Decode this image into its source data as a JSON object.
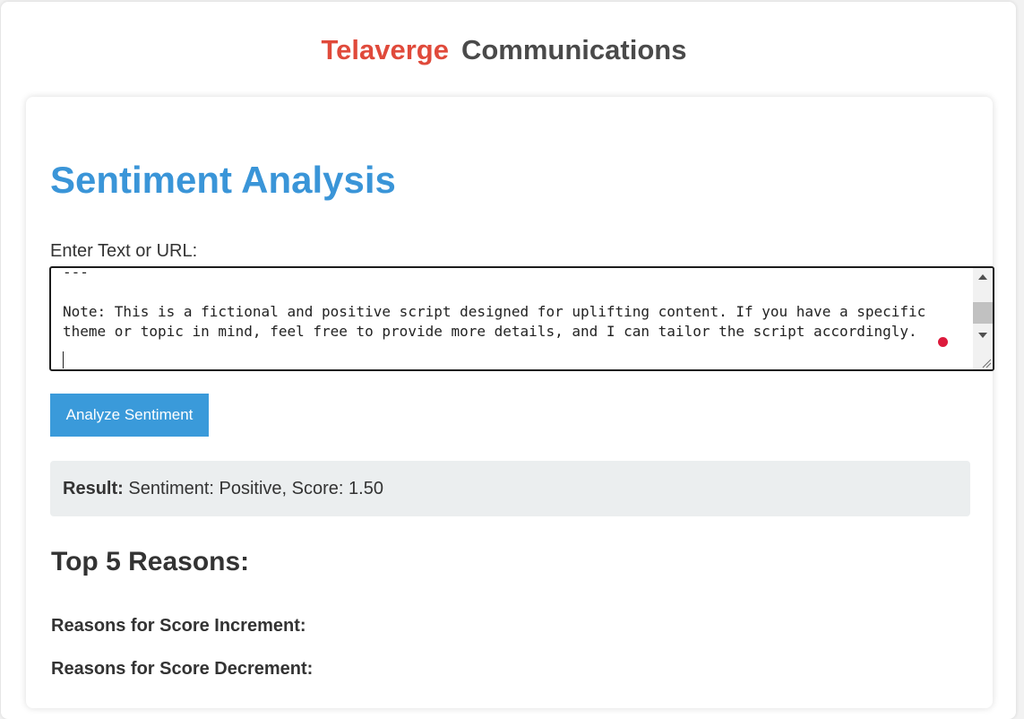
{
  "brand": {
    "part1": "Telaverge",
    "part2": "Communications",
    "part1_color": "#e04a3b",
    "part2_color": "#4a4a4a"
  },
  "page": {
    "title": "Sentiment Analysis",
    "title_color": "#3a95d8"
  },
  "input": {
    "label": "Enter Text or URL:",
    "value": "---\n\nNote: This is a fictional and positive script designed for uplifting content. If you have a specific theme or topic in mind, feel free to provide more details, and I can tailor the script accordingly."
  },
  "actions": {
    "analyze_label": "Analyze Sentiment",
    "button_color": "#3a9ada"
  },
  "result": {
    "label": "Result:",
    "text": "Sentiment: Positive, Score: 1.50"
  },
  "reasons": {
    "title": "Top 5 Reasons:",
    "increment_heading": "Reasons for Score Increment:",
    "decrement_heading": "Reasons for Score Decrement:"
  },
  "icons": {
    "scroll_up": "triangle-up-icon",
    "scroll_down": "triangle-down-icon",
    "resize": "resize-grip-icon",
    "grammar": "grammar-dot-icon"
  }
}
